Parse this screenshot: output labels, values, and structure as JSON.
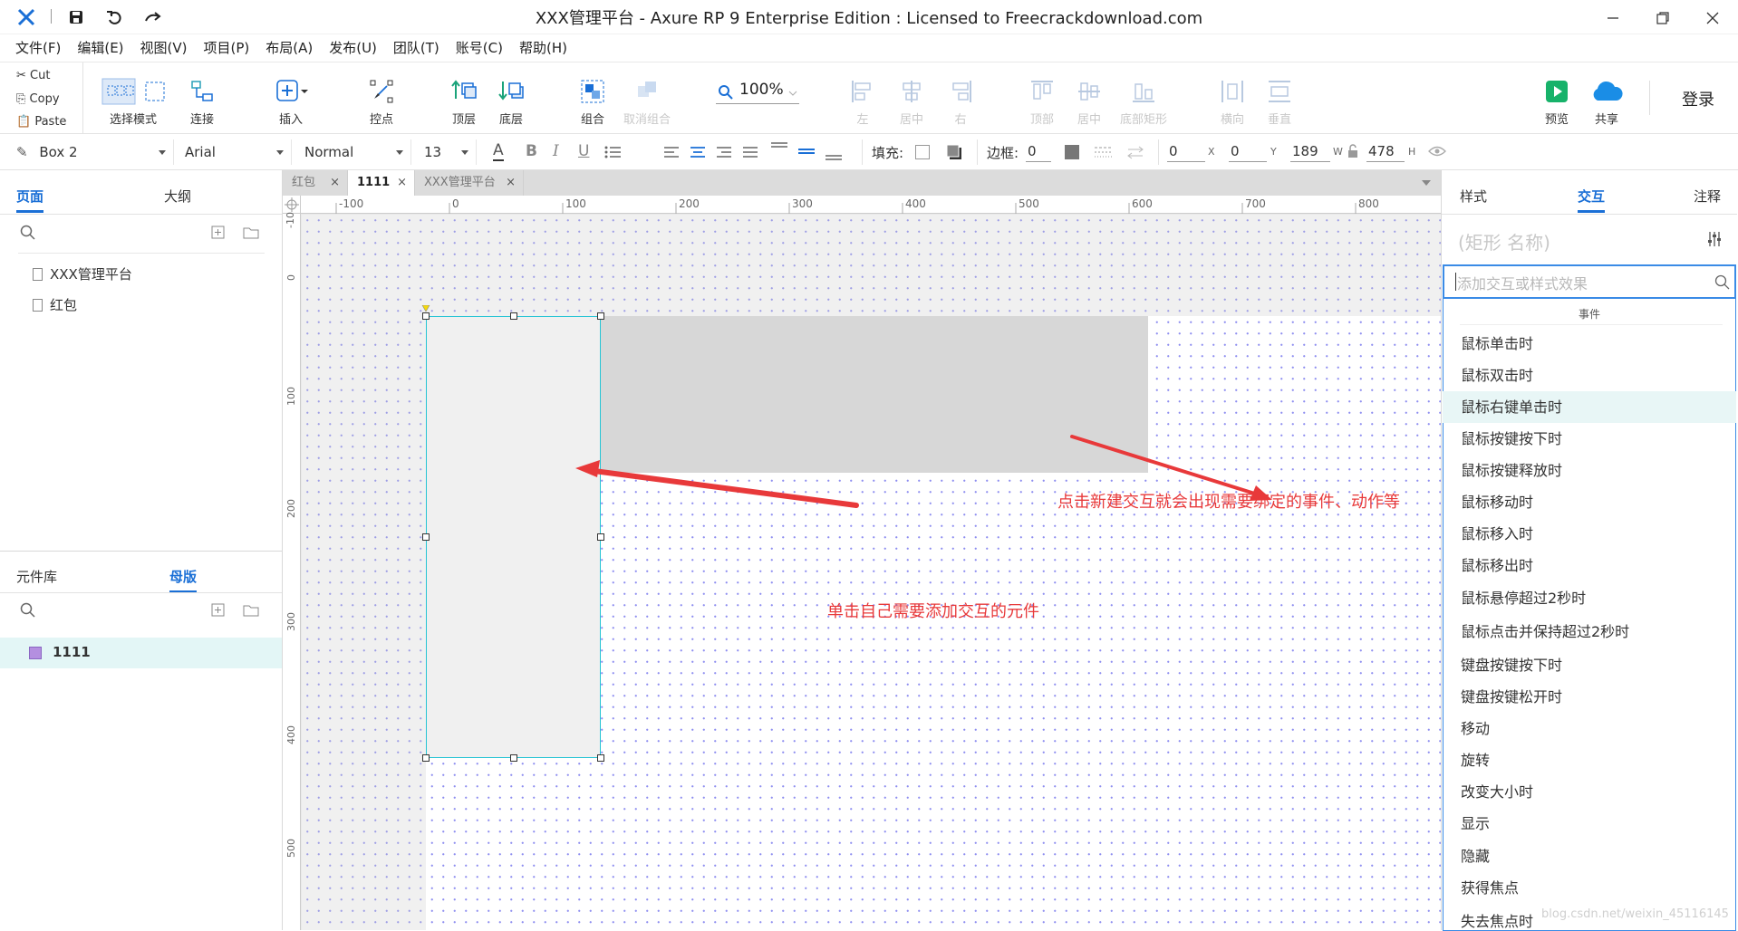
{
  "window": {
    "title": "XXX管理平台 - Axure RP 9 Enterprise Edition : Licensed to Freecrackdownload.com"
  },
  "menu": [
    "文件(F)",
    "编辑(E)",
    "视图(V)",
    "项目(P)",
    "布局(A)",
    "发布(U)",
    "团队(T)",
    "账号(C)",
    "帮助(H)"
  ],
  "clipboard": {
    "cut": "Cut",
    "copy": "Copy",
    "paste": "Paste"
  },
  "toolbar": {
    "select_mode": "选择模式",
    "connect": "连接",
    "insert": "插入",
    "point": "控点",
    "top": "顶层",
    "bottom": "底层",
    "group": "组合",
    "ungroup": "取消组合",
    "zoom": "100%",
    "align_left": "左",
    "align_center": "居中",
    "align_right": "右",
    "align_top": "顶部",
    "align_middle": "居中",
    "align_bottom": "底部矩形",
    "dist_h": "横向",
    "dist_v": "垂直",
    "preview": "预览",
    "share": "共享",
    "login": "登录"
  },
  "format": {
    "widget": "Box 2",
    "font": "Arial",
    "style": "Normal",
    "size": "13",
    "fill_label": "填充:",
    "border_label": "边框:",
    "border_value": "0",
    "x": "0",
    "y": "0",
    "w": "189",
    "h": "478",
    "x_label": "X",
    "y_label": "Y",
    "w_label": "W",
    "h_label": "H"
  },
  "left": {
    "tab_pages": "页面",
    "tab_outline": "大纲",
    "pages": [
      "XXX管理平台",
      "红包"
    ],
    "tab_library": "元件库",
    "tab_masters": "母版",
    "masters": [
      "1111"
    ]
  },
  "doctabs": [
    {
      "label": "红包",
      "close": "×"
    },
    {
      "label": "1111",
      "close": "×"
    },
    {
      "label": "XXX管理平台",
      "close": "×"
    }
  ],
  "ruler": {
    "top": [
      "-100",
      "0",
      "100",
      "200",
      "300",
      "400",
      "500",
      "600",
      "700",
      "800"
    ],
    "left": [
      "-10",
      "0",
      "100",
      "200",
      "300",
      "400",
      "500"
    ]
  },
  "annotations": {
    "right_note": "点击新建交互就会出现需要绑定的事件、动作等",
    "left_note": "单击自己需要添加交互的元件"
  },
  "right": {
    "tab_style": "样式",
    "tab_interact": "交互",
    "tab_notes": "注释",
    "name_placeholder": "(矩形 名称)",
    "search_placeholder": "添加交互或样式效果",
    "section": "事件",
    "events": [
      "鼠标单击时",
      "鼠标双击时",
      "鼠标右键单击时",
      "鼠标按键按下时",
      "鼠标按键释放时",
      "鼠标移动时",
      "鼠标移入时",
      "鼠标移出时",
      "鼠标悬停超过2秒时",
      "鼠标点击并保持超过2秒时",
      "键盘按键按下时",
      "键盘按键松开时",
      "移动",
      "旋转",
      "改变大小时",
      "显示",
      "隐藏",
      "获得焦点",
      "失去焦点时"
    ],
    "watermark": "blog.csdn.net/weixin_45116145"
  },
  "colors": {
    "accent": "#1a6fd6",
    "teal": "#00b8c8",
    "annotation": "#e8393a",
    "highlight": "#e8f6f6"
  }
}
